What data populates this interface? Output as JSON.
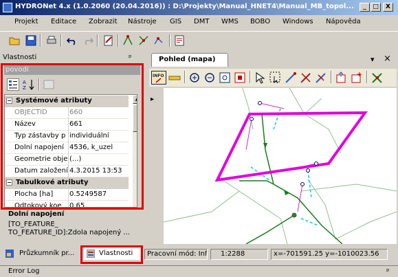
{
  "window": {
    "title": "HYDRONet 4.x (1.0.2060 (20.04.2016)) : D:\\Projekty\\Manual_HNET4\\Manual_MB_topol...",
    "buttons": {
      "minimize": "_",
      "maximize": "□",
      "close": "X"
    }
  },
  "menu": [
    "Projekt",
    "Editace",
    "Zobrazit",
    "Nástroje",
    "GIS",
    "DMT",
    "WMS",
    "BOBO",
    "Windows",
    "Nápověda"
  ],
  "properties_panel": {
    "title": "Vlastnosti",
    "pin": "ᵖ",
    "object_name": "povodi",
    "categories": [
      {
        "label": "Systémové atributy",
        "toggle": "−",
        "rows": [
          {
            "name": "OBJECTID",
            "value": "660",
            "readonly": true
          },
          {
            "name": "Název",
            "value": "661",
            "readonly": false
          },
          {
            "name": "Typ zástavby p",
            "value": "individuální",
            "readonly": false
          },
          {
            "name": "Dolní napojení",
            "value": "4536, k_uzel",
            "readonly": false
          },
          {
            "name": "Geometrie obje",
            "value": "(...)",
            "readonly": false
          },
          {
            "name": "Datum založení",
            "value": "4.3.2015 13:53",
            "readonly": false
          }
        ]
      },
      {
        "label": "Tabulkové atributy",
        "toggle": "−",
        "rows": [
          {
            "name": "Plocha [ha]",
            "value": "0.5249587",
            "readonly": false
          },
          {
            "name": "Odtokový koe",
            "value": "0.65",
            "readonly": false
          }
        ]
      }
    ],
    "description": {
      "title": "Dolní napojení",
      "text": "[TO_FEATURE_\nTO_FEATURE_ID]:Zdola napojený ..."
    }
  },
  "bottom_tabs": [
    {
      "label": "Průzkumník pr...",
      "active": false
    },
    {
      "label": "Vlastnosti",
      "active": true
    }
  ],
  "error_log": {
    "title": "Error Log",
    "pin": "ᵖ"
  },
  "map_panel": {
    "tab_label": "Pohled (mapa)",
    "dropdown": "▾",
    "close": "×",
    "arrow": "▸"
  },
  "status": {
    "mode": "Pracovní mód: Info",
    "scale": "1:2288",
    "coords": "x=-701591.25 y=-1010023.56"
  },
  "colors": {
    "selection_outline": "#e00000",
    "polygon_highlight": "#e000e0",
    "stream": "#1a7a1a",
    "boundary": "#8cc08c",
    "dashed": "#00c8e8"
  }
}
